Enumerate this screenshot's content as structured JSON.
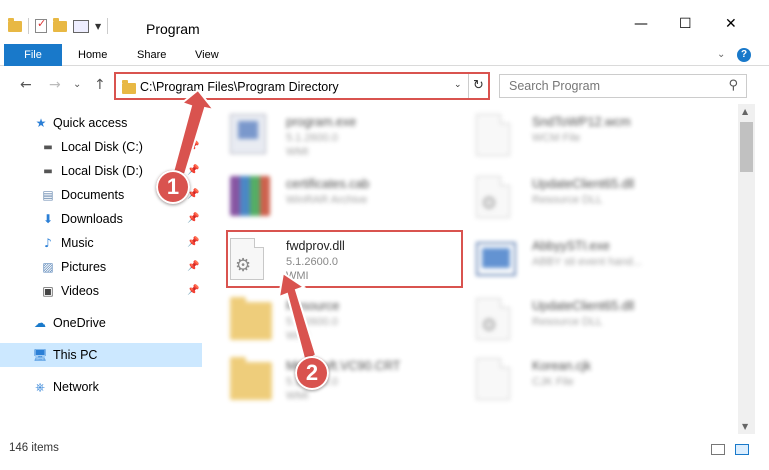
{
  "window": {
    "title": "Program",
    "minimize": "—",
    "maximize": "☐",
    "close": "✕"
  },
  "ribbon": {
    "file": "File",
    "home": "Home",
    "share": "Share",
    "view": "View",
    "help": "?"
  },
  "nav": {
    "back": "←",
    "forward": "→",
    "recent": "⌄",
    "up": "↑",
    "address": "C:\\Program Files\\Program Directory",
    "search_placeholder": "Search Program"
  },
  "sidebar": {
    "items": [
      {
        "label": "Quick access",
        "icon": "star-icon"
      },
      {
        "label": "Local Disk (C:)",
        "icon": "drive-icon"
      },
      {
        "label": "Local Disk (D:)",
        "icon": "drive-icon"
      },
      {
        "label": "Documents",
        "icon": "documents-icon"
      },
      {
        "label": "Downloads",
        "icon": "download-icon"
      },
      {
        "label": "Music",
        "icon": "music-icon"
      },
      {
        "label": "Pictures",
        "icon": "pictures-icon"
      },
      {
        "label": "Videos",
        "icon": "videos-icon"
      },
      {
        "label": "OneDrive",
        "icon": "cloud-icon"
      },
      {
        "label": "This PC",
        "icon": "computer-icon"
      },
      {
        "label": "Network",
        "icon": "network-icon"
      }
    ]
  },
  "files": [
    {
      "name": "program.exe",
      "meta1": "5.1.2600.0",
      "meta2": "WMI"
    },
    {
      "name": "SndToWP12.wcm",
      "meta1": "WCM File",
      "meta2": ""
    },
    {
      "name": "certificates.cab",
      "meta1": "WinRAR Archive",
      "meta2": ""
    },
    {
      "name": "UpdateClient65.dll",
      "meta1": "Resource DLL",
      "meta2": ""
    },
    {
      "name": "fwdprov.dll",
      "meta1": "5.1.2600.0",
      "meta2": "WMI"
    },
    {
      "name": "AbbyySTI.exe",
      "meta1": "ABBY sti event hand...",
      "meta2": ""
    },
    {
      "name": "Resource",
      "meta1": "5.1.2600.0",
      "meta2": "WMI"
    },
    {
      "name": "UpdateClient65.dll",
      "meta1": "Resource DLL",
      "meta2": ""
    },
    {
      "name": "Microsoft.VC90.CRT",
      "meta1": "5.1.2600.0",
      "meta2": "WMI"
    },
    {
      "name": "Korean.cjk",
      "meta1": "CJK File",
      "meta2": ""
    }
  ],
  "status": {
    "item_count": "146 items"
  },
  "markers": {
    "one": "1",
    "two": "2"
  },
  "colors": {
    "accent": "#1979ca",
    "highlight": "#d9534f",
    "selected": "#cce8ff"
  }
}
